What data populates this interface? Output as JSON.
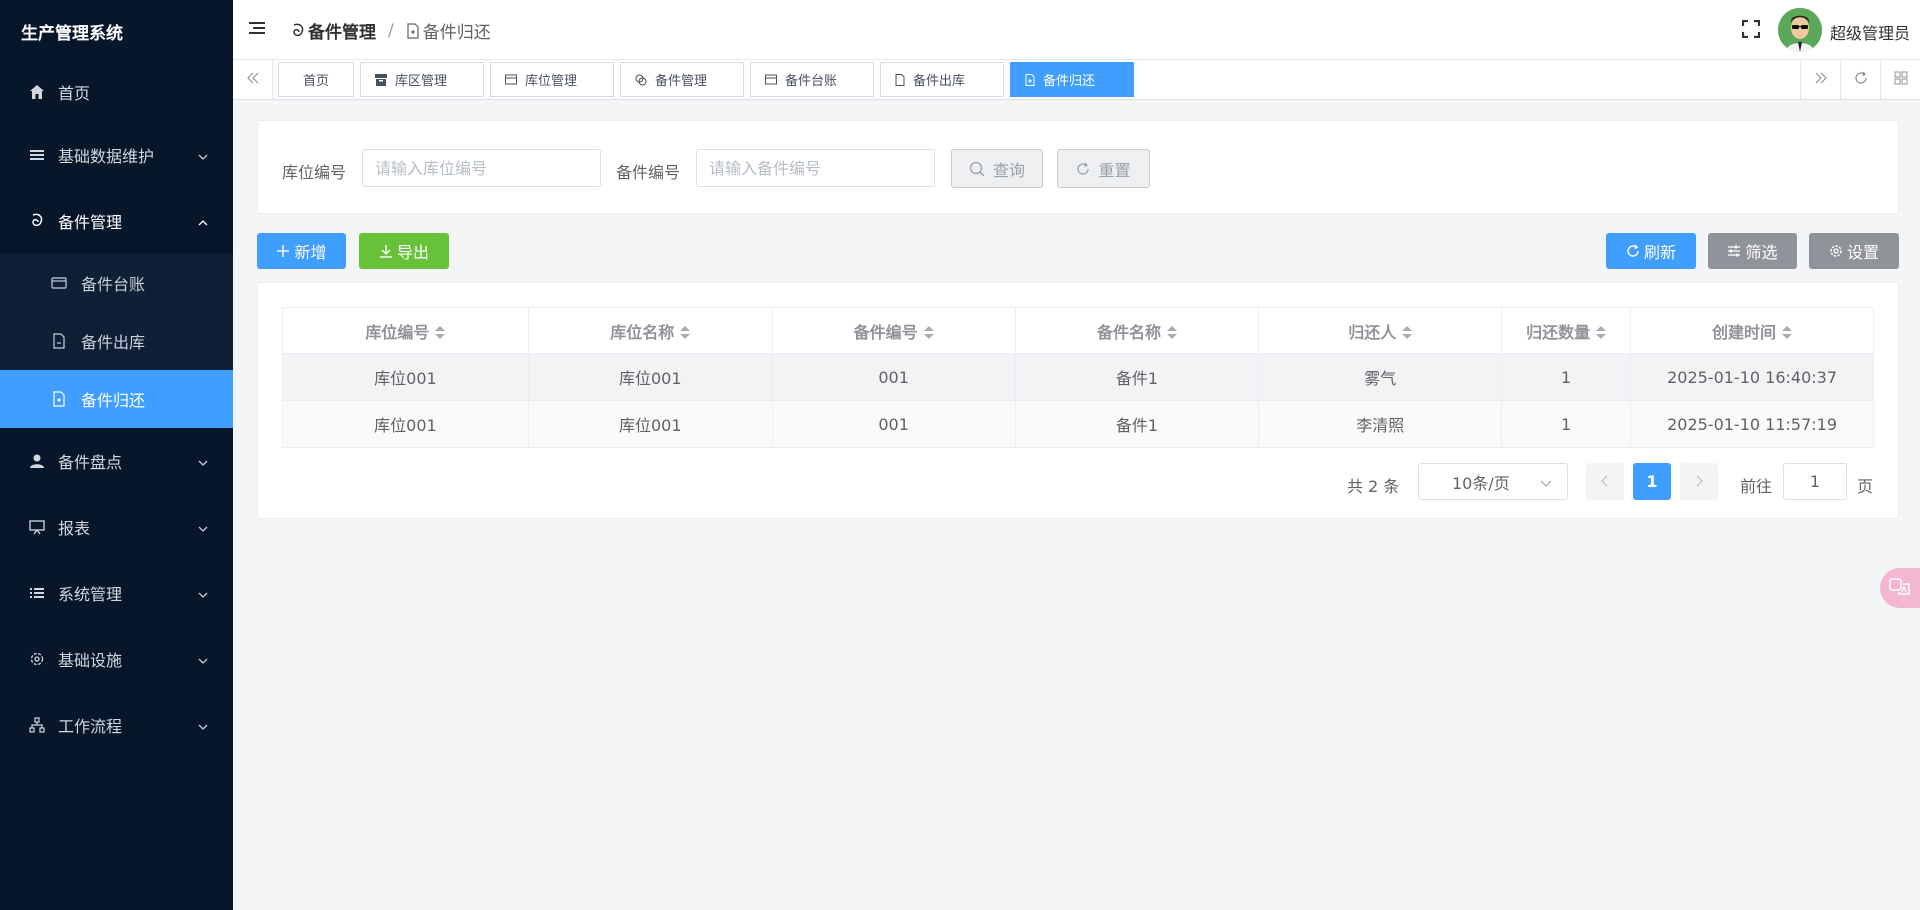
{
  "app": {
    "title": "生产管理系统"
  },
  "sidebar": {
    "items": [
      {
        "label": "首页",
        "icon": "home-icon",
        "expanded": false
      },
      {
        "label": "基础数据维护",
        "icon": "list-icon",
        "expanded": false
      },
      {
        "label": "备件管理",
        "icon": "spiral-icon",
        "expanded": true,
        "children": [
          {
            "label": "备件台账",
            "icon": "card-icon"
          },
          {
            "label": "备件出库",
            "icon": "document-icon"
          },
          {
            "label": "备件归还",
            "icon": "document-add-icon",
            "active": true
          }
        ]
      },
      {
        "label": "备件盘点",
        "icon": "user-icon",
        "expanded": false
      },
      {
        "label": "报表",
        "icon": "presentation-icon",
        "expanded": false
      },
      {
        "label": "系统管理",
        "icon": "list-bullets-icon",
        "expanded": false
      },
      {
        "label": "基础设施",
        "icon": "gear-icon",
        "expanded": false
      },
      {
        "label": "工作流程",
        "icon": "tree-icon",
        "expanded": false
      }
    ]
  },
  "header": {
    "breadcrumb": [
      "备件管理",
      "备件归还"
    ],
    "separator": "/",
    "user": "超级管理员"
  },
  "tabs": [
    {
      "label": "首页",
      "icon": ""
    },
    {
      "label": "库区管理",
      "icon": "box-icon"
    },
    {
      "label": "库位管理",
      "icon": "card-icon"
    },
    {
      "label": "备件管理",
      "icon": "link-icon"
    },
    {
      "label": "备件台账",
      "icon": "card-icon"
    },
    {
      "label": "备件出库",
      "icon": "document-icon"
    },
    {
      "label": "备件归还",
      "icon": "document-add-icon",
      "active": true
    }
  ],
  "search": {
    "location_label": "库位编号",
    "location_placeholder": "请输入库位编号",
    "location_value": "",
    "part_label": "备件编号",
    "part_placeholder": "请输入备件编号",
    "part_value": "",
    "query_label": "查询",
    "reset_label": "重置"
  },
  "actions": {
    "add_label": "新增",
    "export_label": "导出",
    "refresh_label": "刷新",
    "filter_label": "筛选",
    "settings_label": "设置"
  },
  "table": {
    "columns": [
      "库位编号",
      "库位名称",
      "备件编号",
      "备件名称",
      "归还人",
      "归还数量",
      "创建时间"
    ],
    "rows": [
      [
        "库位001",
        "库位001",
        "001",
        "备件1",
        "雾气",
        "1",
        "2025-01-10 16:40:37"
      ],
      [
        "库位001",
        "库位001",
        "001",
        "备件1",
        "李清照",
        "1",
        "2025-01-10 11:57:19"
      ]
    ]
  },
  "pagination": {
    "total_text": "共 2 条",
    "page_size": "10条/页",
    "current_page": "1",
    "goto_label": "前往",
    "goto_value": "1",
    "page_suffix": "页"
  },
  "colors": {
    "sidebar_bg": "#071629",
    "primary": "#409eff",
    "success": "#67c23a",
    "info": "#909399"
  }
}
